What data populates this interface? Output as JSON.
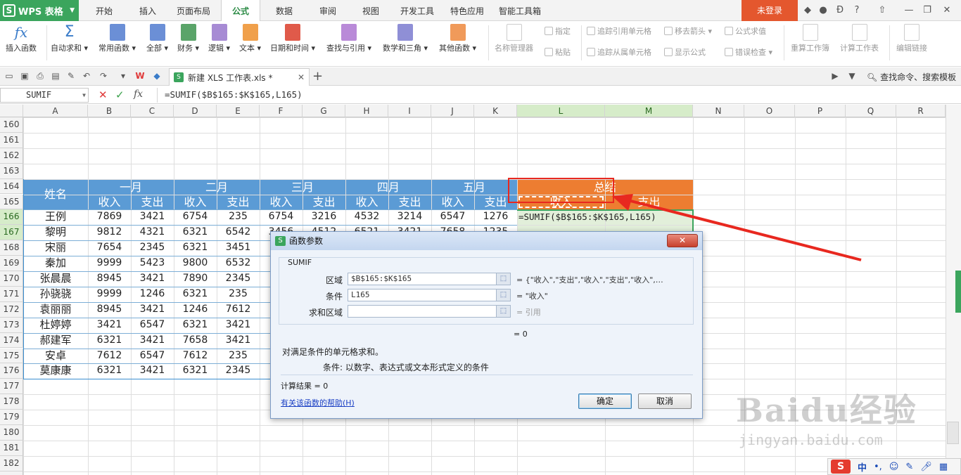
{
  "app": {
    "name": "WPS 表格"
  },
  "menu": {
    "items": [
      "开始",
      "插入",
      "页面布局",
      "公式",
      "数据",
      "审阅",
      "视图",
      "开发工具",
      "特色应用",
      "智能工具箱"
    ],
    "active": "公式",
    "login_label": "未登录"
  },
  "ribbon": {
    "buttons": [
      "插入函数",
      "自动求和",
      "常用函数",
      "全部",
      "财务",
      "逻辑",
      "文本",
      "日期和时间",
      "查找与引用",
      "数学和三角",
      "其他函数",
      "名称管理器"
    ],
    "small": [
      "指定",
      "粘贴",
      "追踪引用单元格",
      "追踪从属单元格",
      "移去箭头",
      "显示公式",
      "公式求值",
      "错误检查"
    ],
    "right": [
      "重算工作簿",
      "计算工作表",
      "编辑链接"
    ],
    "fx_symbol": "fx",
    "sigma_symbol": "Σ"
  },
  "doc": {
    "tab_title": "新建 XLS 工作表.xls *",
    "search": "查找命令、搜索模板"
  },
  "formula_bar": {
    "name_box": "SUMIF",
    "formula": "=SUMIF($B$165:$K$165,L165)"
  },
  "sheet": {
    "columns": [
      "A",
      "B",
      "C",
      "D",
      "E",
      "F",
      "G",
      "H",
      "I",
      "J",
      "K",
      "L",
      "M",
      "N",
      "O",
      "P",
      "Q",
      "R"
    ],
    "rows": [
      160,
      161,
      162,
      163,
      164,
      165,
      166,
      167,
      168,
      169,
      170,
      171,
      172,
      173,
      174,
      175,
      176,
      177,
      178,
      179,
      180,
      181,
      182,
      183
    ],
    "header_name": "姓名",
    "months": [
      "一月",
      "二月",
      "三月",
      "四月",
      "五月"
    ],
    "summary": "总结",
    "income": "收入",
    "expense": "支出",
    "data": [
      [
        "王例",
        "7869",
        "3421",
        "6754",
        "235",
        "6754",
        "3216",
        "4532",
        "3214",
        "6547",
        "1276"
      ],
      [
        "黎明",
        "9812",
        "4321",
        "6321",
        "6542",
        "3456",
        "4512",
        "6521",
        "3421",
        "7658",
        "1235"
      ],
      [
        "宋丽",
        "7654",
        "2345",
        "6321",
        "3451"
      ],
      [
        "秦加",
        "9999",
        "5423",
        "9800",
        "6532"
      ],
      [
        "张晨晨",
        "8945",
        "3421",
        "7890",
        "2345"
      ],
      [
        "孙骁骁",
        "9999",
        "1246",
        "6321",
        "235"
      ],
      [
        "袁丽丽",
        "8945",
        "3421",
        "1246",
        "7612"
      ],
      [
        "杜婷婷",
        "3421",
        "6547",
        "6321",
        "3421"
      ],
      [
        "郝建军",
        "6321",
        "3421",
        "7658",
        "3421"
      ],
      [
        "安卓",
        "7612",
        "6547",
        "7612",
        "235"
      ],
      [
        "莫康康",
        "6321",
        "3421",
        "6321",
        "2345"
      ]
    ],
    "editing_cell": "=SUMIF($B$165:$K$165,L165)",
    "colors": {
      "blue_header": "#5b9bd5",
      "orange_header": "#ed7d31",
      "selected_fill": "#e2efda"
    }
  },
  "dialog": {
    "title": "函数参数",
    "function": "SUMIF",
    "params": [
      {
        "label": "区域",
        "value": "$B$165:$K$165",
        "eq": "= {\"收入\",\"支出\",\"收入\",\"支出\",\"收入\",…"
      },
      {
        "label": "条件",
        "value": "L165",
        "eq": "= \"收入\""
      },
      {
        "label": "求和区域",
        "value": "",
        "eq": "= 引用"
      }
    ],
    "result": "= 0",
    "description": "对满足条件的单元格求和。",
    "param_desc": "条件:  以数字、表达式或文本形式定义的条件",
    "calc_result": "计算结果 = 0",
    "help_link": "有关该函数的帮助(H)",
    "ok": "确定",
    "cancel": "取消"
  },
  "watermark": {
    "main": "Baidu经验",
    "sub": "jingyan.baidu.com"
  },
  "ime": {
    "lang": "中"
  }
}
